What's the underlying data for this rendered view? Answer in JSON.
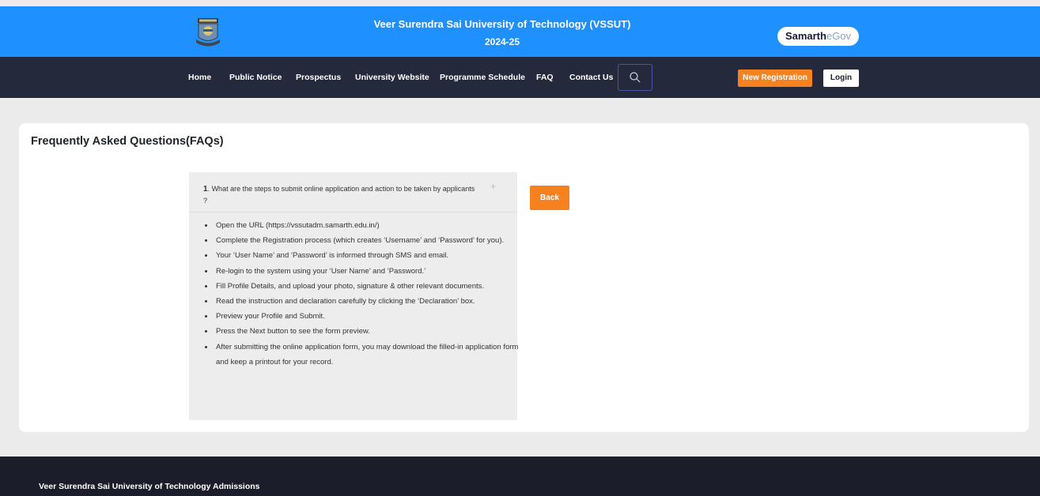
{
  "header": {
    "university_name": "Veer Surendra Sai University of Technology (VSSUT)",
    "session": "2024-25",
    "badge_part1": "Samarth",
    "badge_part2": "eGov"
  },
  "nav": {
    "items": [
      "Home",
      "Public Notice",
      "Prospectus",
      "University Website",
      "Programme Schedule",
      "FAQ",
      "Contact Us"
    ],
    "new_registration": "New Registration",
    "login": "Login"
  },
  "main": {
    "title": "Frequently Asked Questions(FAQs)",
    "faq": {
      "number": "1",
      "question": ". What are the steps to submit online application and action to be taken by applicants ?",
      "toggle": "+",
      "answers": [
        "Open the URL (https://vssutadm.samarth.edu.in/)",
        "Complete the Registration process (which creates ‘Username’ and ‘Password’ for you).",
        "Your ‘User Name’ and ‘Password’ is informed through SMS and email.",
        "Re-login to the system using your ‘User Name’ and ‘Password.’",
        "Fill Profile Details, and upload your photo, signature & other relevant documents.",
        "Read the instruction and declaration carefully by clicking the ‘Declaration’ box.",
        "Preview your Profile and Submit.",
        "Press the Next button to see the form preview.",
        "After submitting the online application form, you may download the filled-in application form and keep a printout for your record."
      ]
    },
    "back_label": "Back"
  },
  "footer": {
    "text": "Veer Surendra Sai University of Technology Admissions"
  },
  "colors": {
    "topbar": "#1e90ff",
    "navbar": "#242a3b",
    "accent": "#f5811f",
    "footer": "#1b1d2a"
  }
}
